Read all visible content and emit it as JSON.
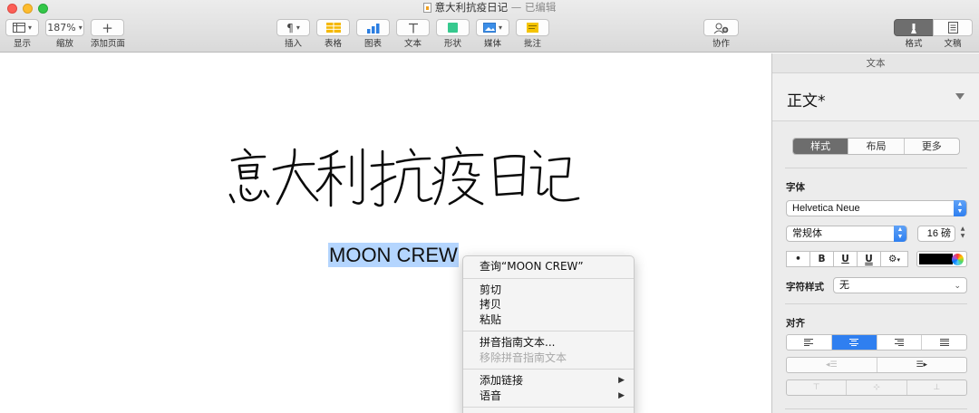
{
  "window": {
    "title": "意大利抗疫日记",
    "status": "— 已编辑"
  },
  "toolbar": {
    "view_label": "显示",
    "zoom_value": "187%",
    "zoom_label": "缩放",
    "add_page_label": "添加页面",
    "insert_label": "插入",
    "table_label": "表格",
    "chart_label": "图表",
    "text_label": "文本",
    "shape_label": "形状",
    "media_label": "媒体",
    "comment_label": "批注",
    "collaborate_label": "协作",
    "format_label": "格式",
    "document_label": "文稿"
  },
  "document": {
    "handwritten_title": "意大利抗疫日记",
    "selected_text": "MOON CREW"
  },
  "context_menu": {
    "lookup": "查询“MOON CREW”",
    "cut": "剪切",
    "copy": "拷贝",
    "paste": "粘贴",
    "phonetic_guide": "拼音指南文本...",
    "remove_phonetic": "移除拼音指南文本",
    "add_link": "添加链接",
    "speech": "语音"
  },
  "inspector": {
    "header": "文本",
    "paragraph_style": "正文*",
    "tabs": [
      "样式",
      "布局",
      "更多"
    ],
    "active_tab": "样式",
    "font_section": "字体",
    "font_family": "Helvetica Neue",
    "font_typeface": "常规体",
    "font_size": "16 磅",
    "format_buttons": [
      "•",
      "B",
      "U",
      "U",
      "⚙"
    ],
    "text_color": "#000000",
    "char_style_label": "字符样式",
    "char_style_value": "无",
    "align_section": "对齐",
    "active_alignment": "center"
  }
}
